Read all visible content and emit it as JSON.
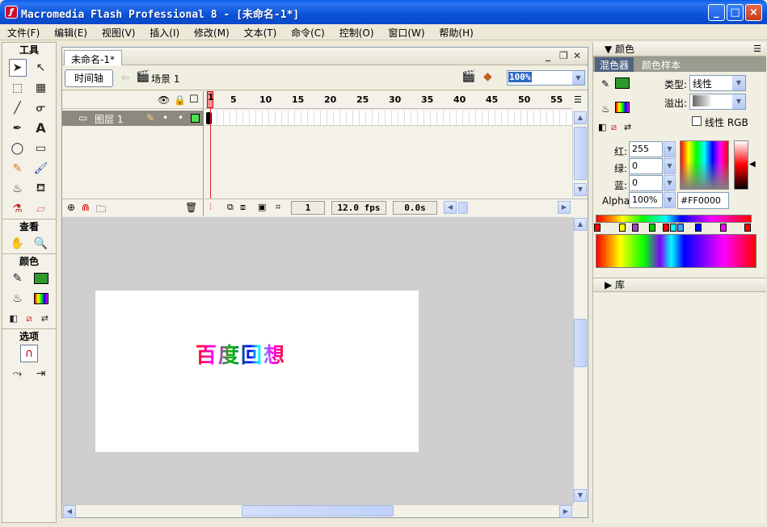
{
  "window": {
    "title": "Macromedia Flash Professional 8 - [未命名-1*]",
    "minimize": "_",
    "maximize": "□",
    "close": "×"
  },
  "menu": [
    "文件(F)",
    "编辑(E)",
    "视图(V)",
    "插入(I)",
    "修改(M)",
    "文本(T)",
    "命令(C)",
    "控制(O)",
    "窗口(W)",
    "帮助(H)"
  ],
  "toolbox": {
    "tools_header": "工具",
    "view_header": "查看",
    "colors_header": "颜色",
    "options_header": "选项"
  },
  "document": {
    "tab": "未命名-1*",
    "timeline_button": "时间轴",
    "scene": "场景 1",
    "zoom": "100%",
    "layer_name": "图层 1",
    "ruler": [
      "1",
      "5",
      "10",
      "15",
      "20",
      "25",
      "30",
      "35",
      "40",
      "45",
      "50",
      "55"
    ],
    "current_frame": "1",
    "fps": "12.0 fps",
    "elapsed": "0.0s",
    "stage_text": "百度回想"
  },
  "color_panel": {
    "title": "颜色",
    "tab_mixer": "混色器",
    "tab_swatches": "颜色样本",
    "type_label": "类型:",
    "type_value": "线性",
    "overflow_label": "溢出:",
    "linear_rgb": "线性 RGB",
    "red_label": "红:",
    "red": "255",
    "green_label": "绿:",
    "green": "0",
    "blue_label": "蓝:",
    "blue": "0",
    "alpha_label": "Alpha:",
    "alpha": "100%",
    "hex": "#FF0000"
  },
  "library_panel": {
    "title": "库"
  },
  "colors": {
    "titlebar": "#0b53d8",
    "stroke_swatch": "#2e9a2e",
    "selected_color": "#FF0000"
  }
}
